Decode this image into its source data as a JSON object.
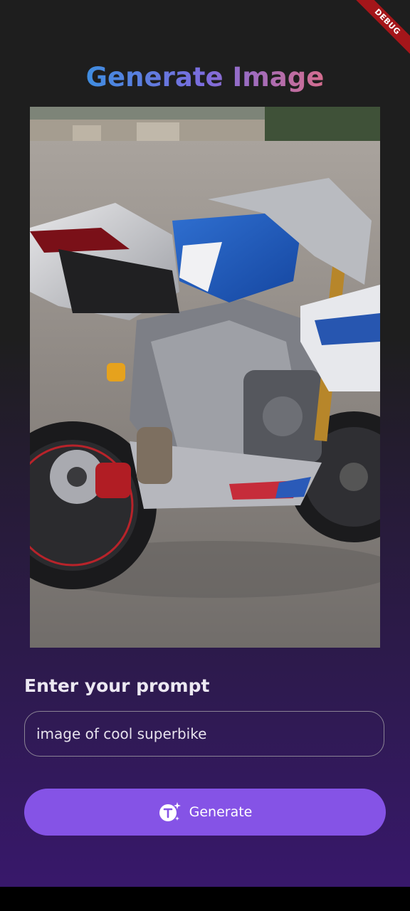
{
  "app": {
    "debug_banner": "DEBUG",
    "title": "Generate Image"
  },
  "image": {
    "alt": "image of cool superbike"
  },
  "prompt": {
    "label": "Enter your prompt",
    "value": "image of cool superbike"
  },
  "generate_button": {
    "label": "Generate",
    "icon": "text-sparkle-icon"
  },
  "colors": {
    "background_top": "#1e1e1e",
    "background_bottom": "#38186b",
    "title_gradient": [
      "#3f8de0",
      "#7c6cdd",
      "#d46d8e"
    ],
    "button": "#8553e6",
    "debug_ribbon": "#a4161a"
  }
}
